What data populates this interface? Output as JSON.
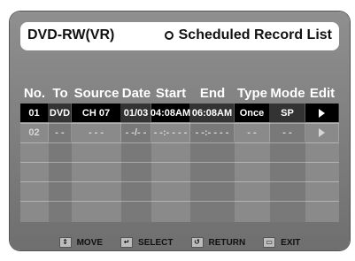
{
  "header": {
    "left_title": "DVD-RW(VR)",
    "right_title": "Scheduled Record List"
  },
  "table": {
    "columns": [
      "No.",
      "To",
      "Source",
      "Date",
      "Start",
      "End",
      "Type",
      "Mode",
      "Edit"
    ],
    "rows": [
      {
        "no": "01",
        "to": "DVD",
        "source": "CH 07",
        "date": "01/03",
        "start": "04:08AM",
        "end": "06:08AM",
        "type": "Once",
        "mode": "SP",
        "edit": "▶"
      },
      {
        "no": "02",
        "to": "- -",
        "source": "- - -",
        "date": "- -/- -",
        "start": "- -:- - - -",
        "end": "- -:- - - -",
        "type": "- -",
        "mode": "- -",
        "edit": "▶"
      }
    ]
  },
  "footer": {
    "move": "MOVE",
    "select": "SELECT",
    "return": "RETURN",
    "exit": "EXIT"
  },
  "colors": {
    "frame": "#7f7f7f",
    "selected_row": "#000000",
    "text": "#ffffff"
  }
}
